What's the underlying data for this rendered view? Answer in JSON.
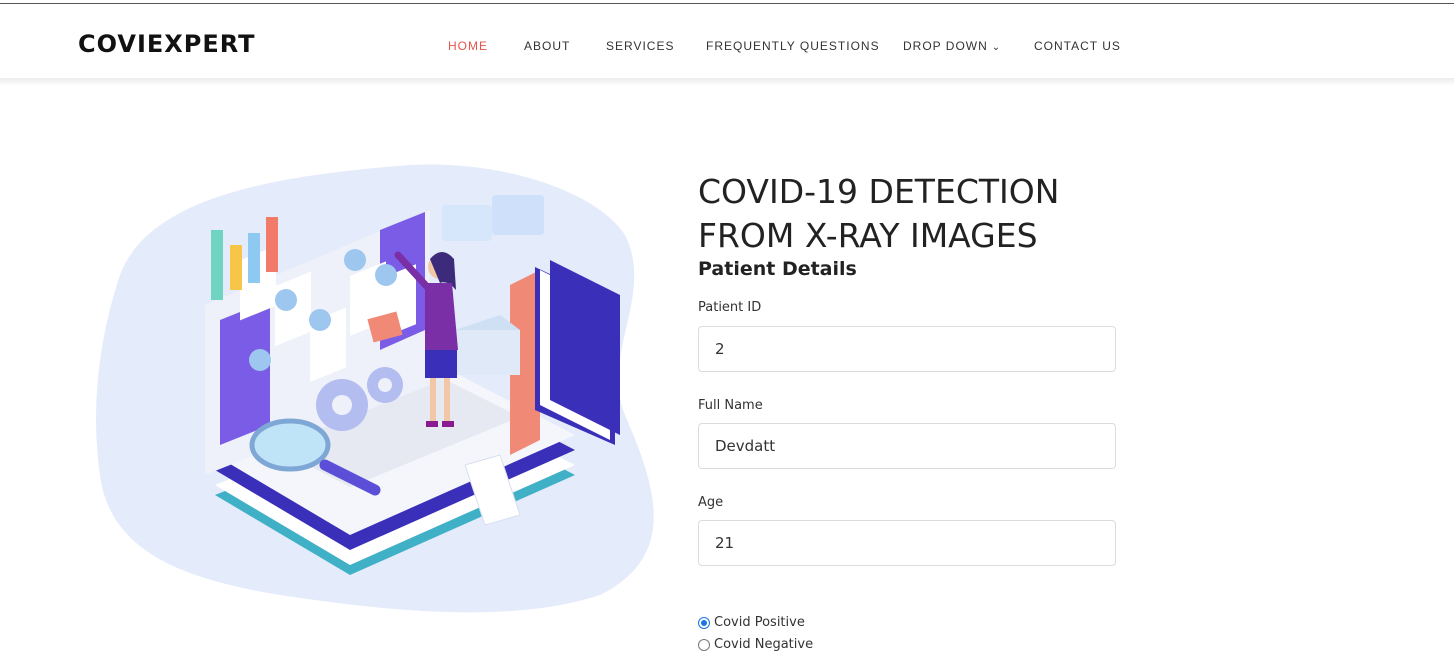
{
  "brand": "COVIEXPERT",
  "nav": {
    "home": "HOME",
    "about": "ABOUT",
    "services": "SERVICES",
    "faq": "FREQUENTLY QUESTIONS",
    "dropdown": "DROP DOWN",
    "dropdown_icon": "chevron-down-icon",
    "contact": "CONTACT US",
    "active": "HOME"
  },
  "hero": {
    "title_line1": "COVID-19 DETECTION",
    "title_line2": "FROM X-RAY IMAGES",
    "subtitle": "Patient Details"
  },
  "form": {
    "patient_id": {
      "label": "Patient ID",
      "value": "2"
    },
    "full_name": {
      "label": "Full Name",
      "value": "Devdatt"
    },
    "age": {
      "label": "Age",
      "value": "21"
    },
    "status": {
      "options": [
        "Covid Positive",
        "Covid Negative"
      ],
      "selected": "Covid Positive"
    }
  },
  "colors": {
    "accent": "#e4554b",
    "radio_selected": "#1a73e8",
    "illustration_bg": "#e4ebfb",
    "purple": "#7a5ce6",
    "indigo": "#3a2fb8"
  }
}
